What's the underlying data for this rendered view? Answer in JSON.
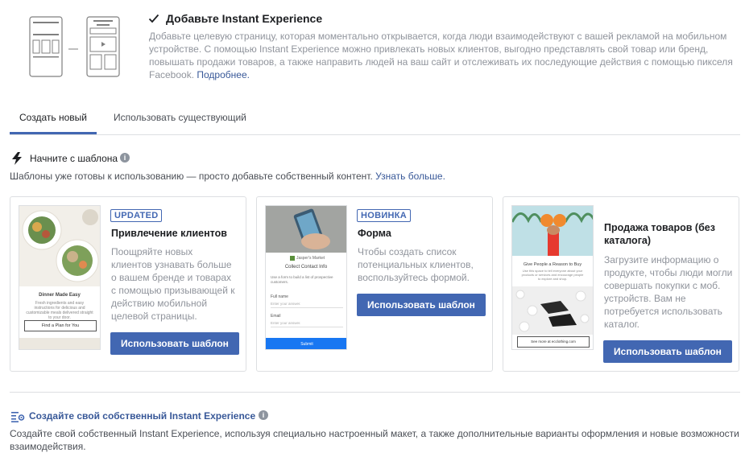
{
  "instant_experience": {
    "checked": true,
    "title": "Добавьте Instant Experience",
    "description": "Добавьте целевую страницу, которая моментально открывается, когда люди взаимодействуют с вашей рекламой на мобильном устройстве. С помощью Instant Experience можно привлекать новых клиентов, выгодно представлять свой товар или бренд, повышать продажи товаров, а также направить людей на ваш сайт и отслеживать их последующие действия с помощью пикселя Facebook.",
    "more_link": "Подробнее."
  },
  "tabs": [
    {
      "label": "Создать новый",
      "active": true
    },
    {
      "label": "Использовать существующий",
      "active": false
    }
  ],
  "template_section": {
    "heading": "Начните с шаблона",
    "subtitle": "Шаблоны уже готовы к использованию — просто добавьте собственный контент.",
    "learn_more": "Узнать больше."
  },
  "cards": [
    {
      "badge": "UPDATED",
      "title": "Привлечение клиентов",
      "description": "Поощряйте новых клиентов узнавать больше о вашем бренде и товарах с помощью призывающей к действию мобильной целевой страницы.",
      "button": "Использовать шаблон",
      "preview": {
        "headline": "Dinner Made Easy",
        "body": "Fresh ingredients and easy instructions for delicious and customizable meals delivered straight to your door.",
        "cta": "Find a Plan for You"
      }
    },
    {
      "badge": "НОВИНКА",
      "title": "Форма",
      "description": "Чтобы создать список потенциальных клиентов, воспользуйтесь формой.",
      "button": "Использовать шаблон",
      "preview": {
        "brand": "Jasper's Market",
        "headline": "Collect Contact Info",
        "body": "Use a form to build a list of prospective customers.",
        "field1": "Full name",
        "field1_placeholder": "Enter your answer.",
        "field2": "Email",
        "field2_placeholder": "Enter your answer.",
        "submit": "Submit"
      }
    },
    {
      "badge": "",
      "title": "Продажа товаров (без каталога)",
      "description": "Загрузите информацию о продукте, чтобы люди могли совершать покупки с моб. устройств. Вам не потребуется использовать каталог.",
      "button": "Использовать шаблон",
      "preview": {
        "headline": "Give People a Reason to Buy",
        "body": "Use this space to tell everyone about your products or services and encourage people to explore and shop.",
        "cta": "See more at ecclothing.com"
      }
    }
  ],
  "own_section": {
    "title": "Создайте свой собственный Instant Experience",
    "description": "Создайте свой собственный Instant Experience, используя специально настроенный макет, а также дополнительные варианты оформления и новые возможности взаимодействия."
  },
  "colors": {
    "accent": "#4267b2",
    "link": "#385898",
    "muted": "#90949c",
    "border": "#dddfe2"
  }
}
